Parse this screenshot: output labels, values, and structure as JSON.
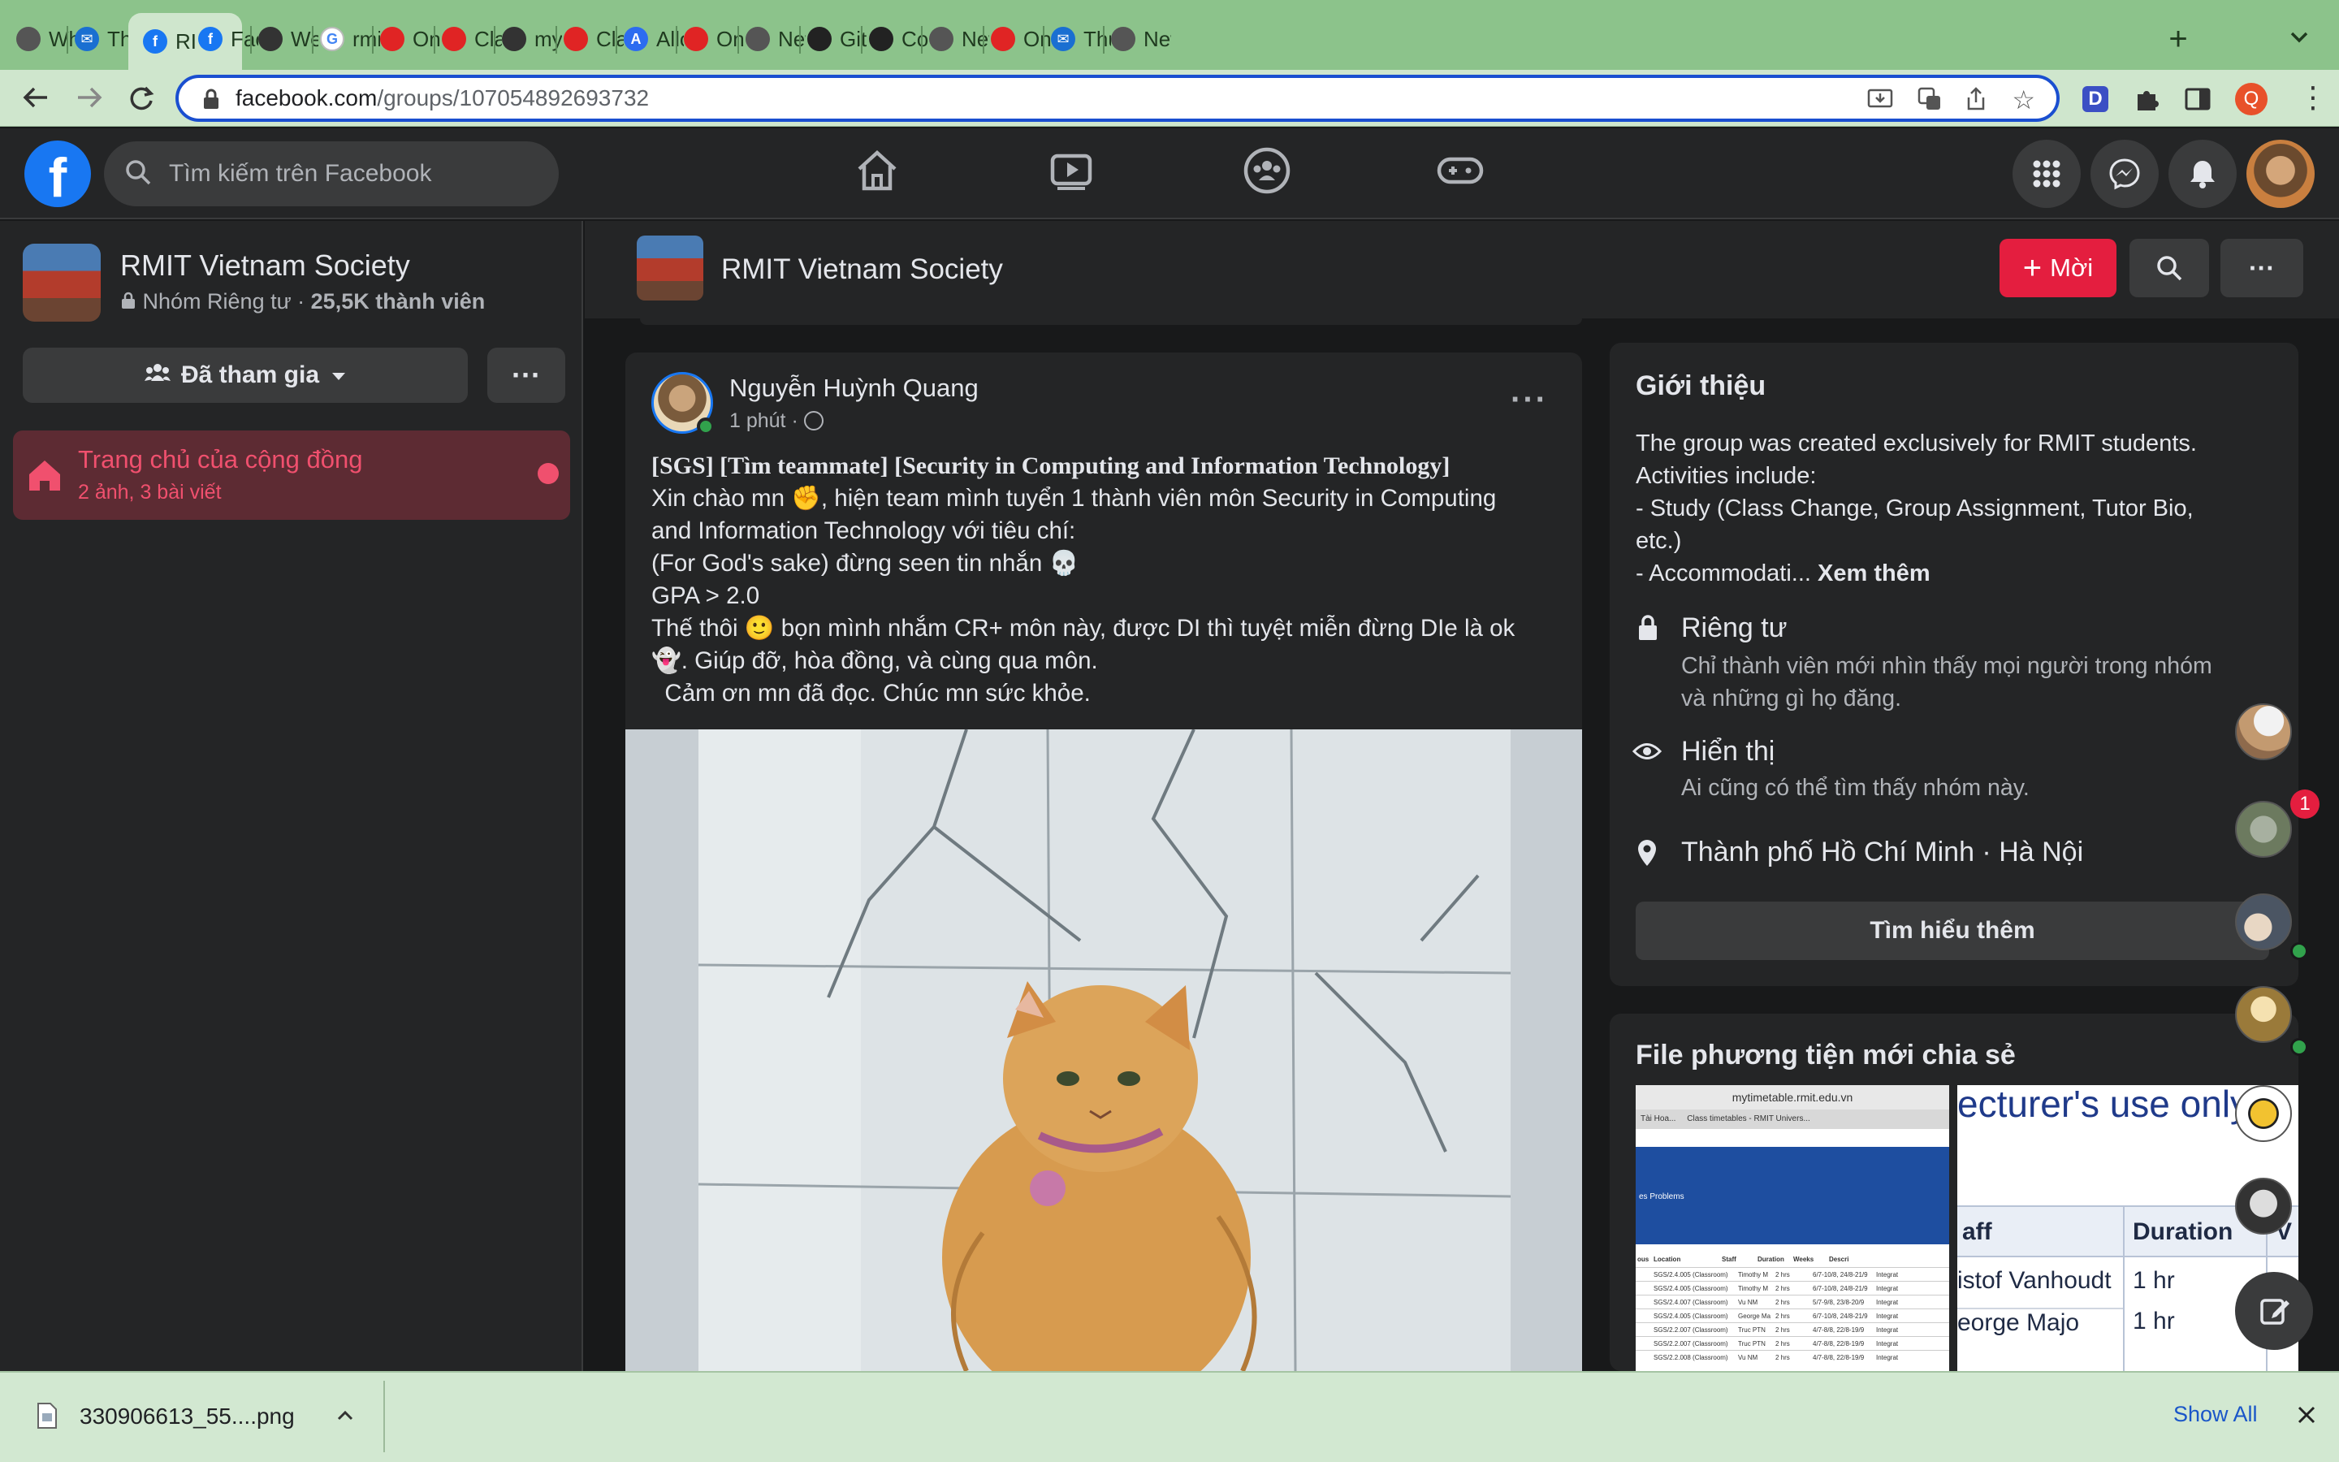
{
  "browser": {
    "tabs": [
      {
        "label": "What",
        "icon": "chrome-icon"
      },
      {
        "label": "Thư",
        "icon": "outlook-icon"
      },
      {
        "label": "RI",
        "icon": "facebook-icon",
        "active": true
      },
      {
        "label": "Facel",
        "icon": "facebook-icon"
      },
      {
        "label": "Welc",
        "icon": "globe-icon"
      },
      {
        "label": "rmit",
        "icon": "google-icon"
      },
      {
        "label": "Onlin",
        "icon": "red-circle-icon"
      },
      {
        "label": "Class",
        "icon": "red-circle-icon"
      },
      {
        "label": "myap",
        "icon": "globe-icon"
      },
      {
        "label": "Class",
        "icon": "red-circle-icon"
      },
      {
        "label": "Alloc",
        "icon": "a-icon"
      },
      {
        "label": "Onlin",
        "icon": "red-circle-icon"
      },
      {
        "label": "New",
        "icon": "chrome-icon"
      },
      {
        "label": "GitHu",
        "icon": "github-icon"
      },
      {
        "label": "Com",
        "icon": "github-icon"
      },
      {
        "label": "New",
        "icon": "chrome-icon"
      },
      {
        "label": "Onlin",
        "icon": "red-circle-icon"
      },
      {
        "label": "Thư",
        "icon": "outlook-icon"
      },
      {
        "label": "New",
        "icon": "chrome-icon"
      }
    ],
    "url_domain": "facebook.com",
    "url_path": "/groups/107054892693732",
    "profile_letter": "Q",
    "ext_letter": "D"
  },
  "fb": {
    "logo": "f",
    "search_placeholder": "Tìm kiếm trên Facebook",
    "notification_count": "1"
  },
  "sidebar": {
    "group_name": "RMIT Vietnam Society",
    "group_meta_a": "Nhóm Riêng tư · ",
    "group_meta_b": "25,5K thành viên",
    "joined_label": "Đã tham gia",
    "more_label": "···",
    "home_title": "Trang chủ của cộng đồng",
    "home_sub": "2 ảnh, 3 bài viết"
  },
  "header": {
    "group_name": "RMIT Vietnam Society",
    "invite_label": "Mời",
    "more_label": "···"
  },
  "post": {
    "author": "Nguyễn Huỳnh Quang",
    "time": "1 phút · ",
    "more": "···",
    "lines": [
      "[SGS] [Tìm teammate] [Security in Computing and Information Technology]",
      "Xin chào mn ✊, hiện team mình tuyển 1 thành viên môn Security in Computing",
      "and Information Technology với tiêu chí:",
      "(For God's sake) đừng seen tin nhắn 💀",
      "GPA > 2.0",
      "Thế thôi 🙂 bọn mình nhắm CR+ môn này, được DI thì tuyệt miễn đừng DIe là ok",
      "👻. Giúp đỡ, hòa đồng, và cùng qua môn.",
      "  Cảm ơn mn đã đọc. Chúc mn sức khỏe."
    ]
  },
  "about": {
    "title": "Giới thiệu",
    "desc_lines": [
      "The group was created exclusively for RMIT students.",
      "Activities include:",
      "- Study (Class Change, Group Assignment, Tutor Bio,",
      "etc.)",
      "- Accommodati... "
    ],
    "see_more": "Xem thêm",
    "private_title": "Riêng tư",
    "private_desc_1": "Chỉ thành viên mới nhìn thấy mọi người trong nhóm",
    "private_desc_2": "và những gì họ đăng.",
    "visible_title": "Hiển thị",
    "visible_desc": "Ai cũng có thể tìm thấy nhóm này.",
    "location": "Thành phố Hồ Chí Minh · Hà Nội",
    "learn_more": "Tìm hiểu thêm"
  },
  "media": {
    "title": "File phương tiện mới chia sẻ",
    "thumb1_url": "mytimetable.rmit.edu.vn",
    "thumb1_tab": "Class timetables - RMIT Univers...",
    "thumb1_tab0": "Tài Hoa...",
    "thumb1_problems": "es Problems",
    "thumb1_cols": [
      "ous",
      "Location",
      "Staff",
      "Duration",
      "Weeks",
      "Descri"
    ],
    "thumb1_rows": [
      [
        "SGS/2.4.005 (Classroom)",
        "Timothy M",
        "2 hrs",
        "6/7-10/8, 24/8-21/9",
        "Integrat"
      ],
      [
        "SGS/2.4.005 (Classroom)",
        "Timothy M",
        "2 hrs",
        "6/7-10/8, 24/8-21/9",
        "Integrat"
      ],
      [
        "SGS/2.4.007 (Classroom)",
        "Vu NM",
        "2 hrs",
        "5/7-9/8, 23/8-20/9",
        "Integrat"
      ],
      [
        "SGS/2.4.005 (Classroom)",
        "George Majo",
        "2 hrs",
        "6/7-10/8, 24/8-21/9",
        "Integrat"
      ],
      [
        "SGS/2.2.007 (Classroom)",
        "Truc PTN",
        "2 hrs",
        "4/7-8/8, 22/8-19/9",
        "Integrat"
      ],
      [
        "SGS/2.2.007 (Classroom)",
        "Truc PTN",
        "2 hrs",
        "4/7-8/8, 22/8-19/9",
        "Integrat"
      ],
      [
        "SGS/2.2.008 (Classroom)",
        "Vu NM",
        "2 hrs",
        "4/7-8/8, 22/8-19/9",
        "Integrat"
      ]
    ],
    "thumb2_heading": "ecturer's use only",
    "thumb2_col_staff": "aff",
    "thumb2_col_duration": "Duration",
    "thumb2_col_extra": "V",
    "thumb2_rows": [
      {
        "name": "istof Vanhoudt",
        "dur": "1 hr",
        "extra": ""
      },
      {
        "name": "eorge Majo",
        "dur": "1 hr",
        "extra": "S"
      }
    ]
  },
  "download": {
    "file": "330906613_55....png",
    "show_all": "Show All"
  }
}
